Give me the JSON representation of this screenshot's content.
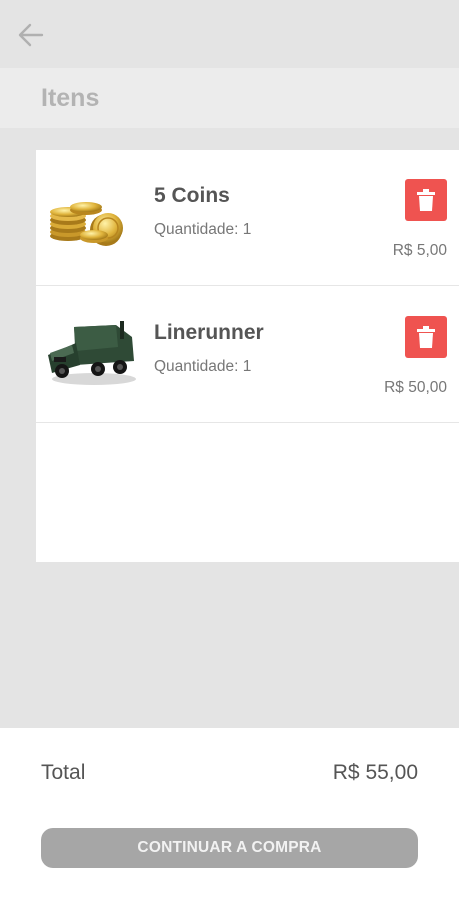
{
  "header": {
    "back_icon": "arrow-left-icon"
  },
  "section": {
    "title": "Itens"
  },
  "cart": {
    "items": [
      {
        "name": "5 Coins",
        "quantity_label": "Quantidade: 1",
        "price": "R$ 5,00",
        "image": "gold-coins-image",
        "delete_icon": "trash-icon"
      },
      {
        "name": "Linerunner",
        "quantity_label": "Quantidade: 1",
        "price": "R$ 50,00",
        "image": "green-truck-image",
        "delete_icon": "trash-icon"
      }
    ]
  },
  "summary": {
    "total_label": "Total",
    "total_value": "R$ 55,00"
  },
  "actions": {
    "continue_label": "CONTINUAR A COMPRA"
  },
  "colors": {
    "delete_button": "#ef5350",
    "continue_button": "#a6a6a6",
    "background": "#e4e4e4"
  }
}
